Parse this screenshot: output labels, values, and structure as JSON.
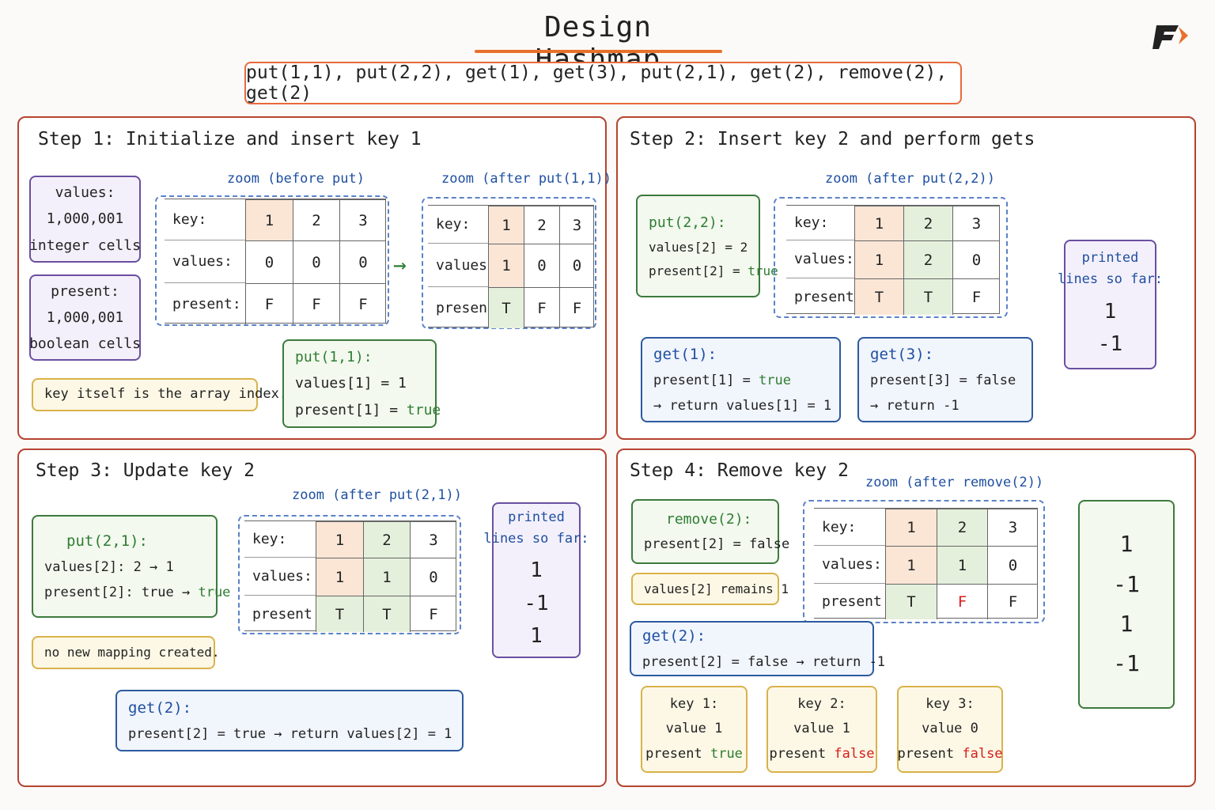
{
  "title": "Design Hashmap",
  "operations": "put(1,1), put(2,2), get(1), get(3), put(2,1), get(2), remove(2), get(2)",
  "logo": "F-logo-icon",
  "colors": {
    "panel_border": "#b5442f",
    "accent_orange": "#e8702a",
    "green": "#2e7d32",
    "blue": "#1e4fa0",
    "red": "#d81b1b"
  },
  "step1": {
    "title": "Step 1:  Initialize and insert key 1",
    "values_box": [
      "values:",
      "1,000,001",
      "integer cells"
    ],
    "present_box": [
      "present:",
      "1,000,001",
      "boolean cells"
    ],
    "note": "key itself is the array index.",
    "zoom_before": "zoom (before put)",
    "zoom_after": "zoom (after put(1,1))",
    "arrow": "→",
    "row_labels": [
      "key:",
      "values:",
      "present:"
    ],
    "before": {
      "keys": [
        "1",
        "2",
        "3"
      ],
      "values": [
        "0",
        "0",
        "0"
      ],
      "present": [
        "F",
        "F",
        "F"
      ]
    },
    "after": {
      "keys": [
        "1",
        "2",
        "3"
      ],
      "values": [
        "1",
        "0",
        "0"
      ],
      "present": [
        "T",
        "F",
        "F"
      ]
    },
    "put": {
      "head": "put(1,1):",
      "l1": "values[1] = 1",
      "l2a": "present[1] = ",
      "l2b": "true"
    }
  },
  "step2": {
    "title": "Step 2:  Insert key 2 and perform gets",
    "zoom": "zoom (after put(2,2))",
    "row_labels": [
      "key:",
      "values:",
      "present:"
    ],
    "table": {
      "keys": [
        "1",
        "2",
        "3"
      ],
      "values": [
        "1",
        "2",
        "0"
      ],
      "present": [
        "T",
        "T",
        "F"
      ]
    },
    "put": {
      "head": "put(2,2):",
      "l1": "values[2] = 2",
      "l2a": "present[2] = ",
      "l2b": "true"
    },
    "get1": {
      "head": "get(1):",
      "l1a": "present[1] = ",
      "l1b": "true",
      "l2": "→ return values[1] = 1"
    },
    "get3": {
      "head": "get(3):",
      "l1": "present[3] = false",
      "l2": "→ return -1"
    },
    "printed": {
      "l1": "printed",
      "l2": "lines so far:",
      "values": [
        "1",
        "-1"
      ]
    }
  },
  "step3": {
    "title": "Step 3:  Update key 2",
    "zoom": "zoom (after put(2,1))",
    "row_labels": [
      "key:",
      "values:",
      "present:"
    ],
    "table": {
      "keys": [
        "1",
        "2",
        "3"
      ],
      "values": [
        "1",
        "1",
        "0"
      ],
      "present": [
        "T",
        "T",
        "F"
      ]
    },
    "put": {
      "head": "put(2,1):",
      "l1": "values[2]: 2 → 1",
      "l2a": "present[2]: true → ",
      "l2b": "true"
    },
    "note": "no new mapping created.",
    "get2": {
      "head": "get(2):",
      "l1": "present[2] = true → return values[2] = 1"
    },
    "printed": {
      "l1": "printed",
      "l2": "lines so far:",
      "values": [
        "1",
        "-1",
        "1"
      ]
    }
  },
  "step4": {
    "title": "Step 4:  Remove key 2",
    "zoom": "zoom (after remove(2))",
    "row_labels": [
      "key:",
      "values:",
      "present:"
    ],
    "table": {
      "keys": [
        "1",
        "2",
        "3"
      ],
      "values": [
        "1",
        "1",
        "0"
      ],
      "present": [
        "T",
        "F",
        "F"
      ]
    },
    "remove": {
      "head": "remove(2):",
      "l1": "present[2] = false"
    },
    "note": "values[2] remains 1",
    "get2": {
      "head": "get(2):",
      "l1": "present[2] = false → return -1"
    },
    "k1": {
      "l1": "key 1:",
      "l2": "value 1",
      "l3a": "present ",
      "l3b": "true"
    },
    "k2": {
      "l1": "key 2:",
      "l2": "value 1",
      "l3a": "present ",
      "l3b": "false"
    },
    "k3": {
      "l1": "key 3:",
      "l2": "value 0",
      "l3a": "present ",
      "l3b": "false"
    },
    "output": [
      "1",
      "-1",
      "1",
      "-1"
    ]
  }
}
